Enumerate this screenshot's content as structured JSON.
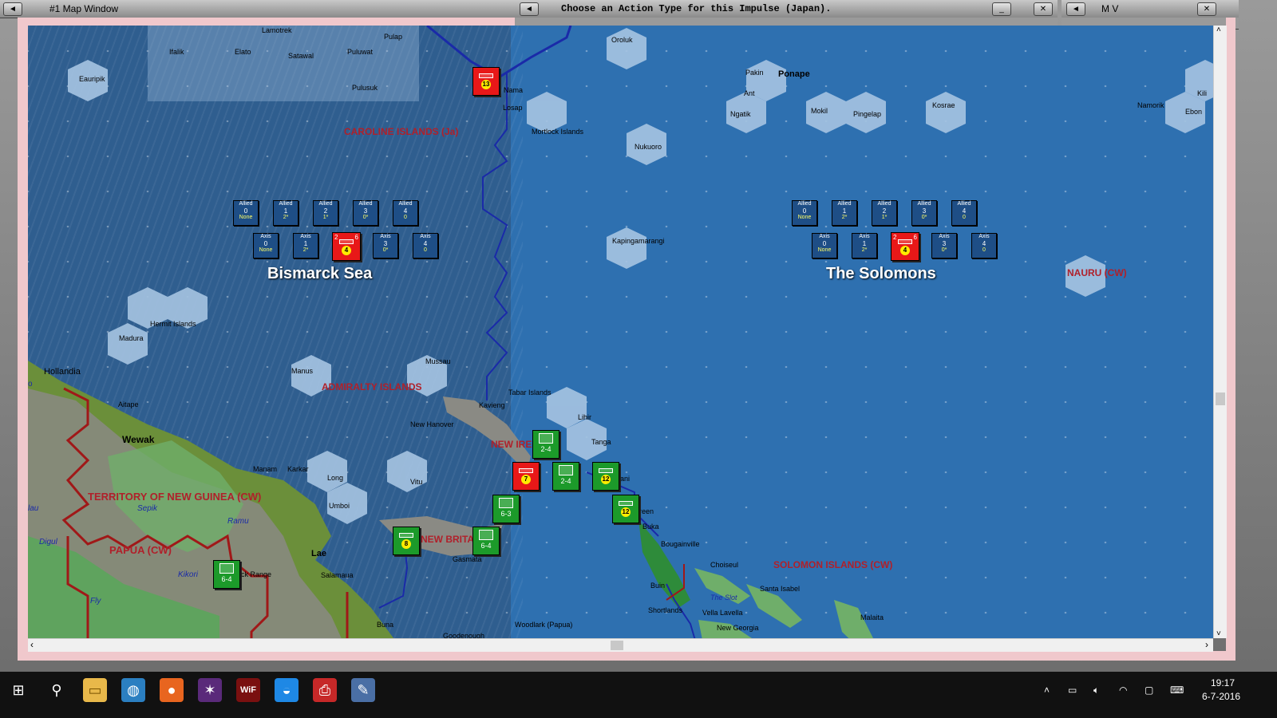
{
  "map_window": {
    "title": "#1 Map Window",
    "left_buttons": [
      "◄"
    ],
    "right_buttons": [
      "_",
      "□",
      "✕"
    ]
  },
  "action_window": {
    "title": "Choose an Action Type for this Impulse (Japan)."
  },
  "mv_window": {
    "title": "M V"
  },
  "sea_areas": {
    "bismarck": {
      "name": "Bismarck Sea",
      "allied_boxes": [
        {
          "label": "Allied",
          "n": "0",
          "v": "None"
        },
        {
          "label": "Allied",
          "n": "1",
          "v": "2*"
        },
        {
          "label": "Allied",
          "n": "2",
          "v": "1*"
        },
        {
          "label": "Allied",
          "n": "3",
          "v": "0*"
        },
        {
          "label": "Allied",
          "n": "4",
          "v": "0"
        }
      ],
      "axis_boxes": [
        {
          "label": "Axis",
          "n": "0",
          "v": "None"
        },
        {
          "label": "Axis",
          "n": "1",
          "v": "2*"
        },
        {
          "label": "Axis",
          "n": "2",
          "v": "6"
        },
        {
          "label": "Axis",
          "n": "3",
          "v": "0*"
        },
        {
          "label": "Axis",
          "n": "4",
          "v": "0"
        }
      ],
      "axis_unit": {
        "left": "2",
        "right": "6",
        "num": "4"
      }
    },
    "solomons": {
      "name": "The Solomons",
      "allied_boxes": [
        {
          "label": "Allied",
          "n": "0",
          "v": "None"
        },
        {
          "label": "Allied",
          "n": "1",
          "v": "2*"
        },
        {
          "label": "Allied",
          "n": "2",
          "v": "1*"
        },
        {
          "label": "Allied",
          "n": "3",
          "v": "0*"
        },
        {
          "label": "Allied",
          "n": "4",
          "v": "0"
        }
      ],
      "axis_boxes": [
        {
          "label": "Axis",
          "n": "0",
          "v": "None"
        },
        {
          "label": "Axis",
          "n": "1",
          "v": "2*"
        },
        {
          "label": "Axis",
          "n": "2",
          "v": "6"
        },
        {
          "label": "Axis",
          "n": "3",
          "v": "0*"
        },
        {
          "label": "Axis",
          "n": "4",
          "v": "0"
        }
      ],
      "axis_unit": {
        "left": "2",
        "right": "6",
        "num": "4"
      }
    }
  },
  "regions": {
    "caroline": "CAROLINE ISLANDS (Ja)",
    "admiralty": "ADMIRALTY ISLANDS",
    "new_ireland": "NEW IRE",
    "new_britain": "NEW BRITA",
    "tng": "TERRITORY OF NEW GUINEA (CW)",
    "papua": "PAPUA (CW)",
    "solomon_islands": "SOLOMON ISLANDS (CW)",
    "nauru": "NAURU (CW)"
  },
  "places": {
    "lamotrek": "Lamotrek",
    "pulap": "Pulap",
    "ifalik": "Ifalik",
    "elato": "Elato",
    "satawal": "Satawal",
    "puluwat": "Puluwat",
    "eauripik": "Eauripik",
    "pulusuk": "Pulusuk",
    "nama": "Nama",
    "losap": "Losap",
    "mortlock": "Mortlock Islands",
    "oroluk": "Oroluk",
    "pakin": "Pakin",
    "ponape": "Ponape",
    "ant": "Ant",
    "ngatik": "Ngatik",
    "mokil": "Mokil",
    "pingelap": "Pingelap",
    "kosrae": "Kosrae",
    "namorik": "Namorik",
    "kili": "Kili",
    "ebon": "Ebon",
    "nukuoro": "Nukuoro",
    "kapingamarangi": "Kapingamarangi",
    "hermit": "Hermit Islands",
    "madura": "Madura",
    "hollandia": "Hollandia",
    "manus": "Manus",
    "mussau": "Mussau",
    "aitape": "Aitape",
    "wewak": "Wewak",
    "tabar": "Tabar Islands",
    "kavieng": "Kavieng",
    "new_hanover": "New Hanover",
    "lihir": "Lihir",
    "tanga": "Tanga",
    "manam": "Manam",
    "karkar": "Karkar",
    "long": "Long",
    "vitu": "Vitu",
    "umboi": "Umboi",
    "sepik": "Sepik",
    "ramu": "Ramu",
    "digul": "Digul",
    "lae": "Lae",
    "kikori": "Kikori",
    "fly": "Fly",
    "range": "ck Range",
    "salamaua": "Salamaua",
    "gasmata": "Gasmata",
    "green": "reen",
    "ani": "ani",
    "buka": "Buka",
    "bougainville": "Bougainville",
    "choiseul": "Choiseul",
    "buin": "Buin",
    "santa_isabel": "Santa Isabel",
    "the_slot": "The Slot",
    "shortlands": "Shortlands",
    "vella": "Vella Lavella",
    "new_georgia": "New Georgia",
    "malaita": "Malaita",
    "buna": "Buna",
    "woodlark": "Woodlark (Papua)",
    "goodenough": "Goodenough",
    "lau": "lau",
    "o": "o"
  },
  "units": [
    {
      "id": "u13",
      "color": "red",
      "num": "13"
    },
    {
      "id": "u7",
      "color": "red",
      "num": "7"
    },
    {
      "id": "u24a",
      "color": "green",
      "str": "2-4"
    },
    {
      "id": "u24b",
      "color": "green",
      "str": "2-4"
    },
    {
      "id": "u12a",
      "color": "green",
      "num": "12"
    },
    {
      "id": "u12b",
      "color": "green",
      "num": "12"
    },
    {
      "id": "u63",
      "color": "green",
      "str": "6-3"
    },
    {
      "id": "u64a",
      "color": "green",
      "str": "6-4"
    },
    {
      "id": "u64b",
      "color": "green",
      "str": "6-4"
    },
    {
      "id": "u8",
      "color": "green",
      "num": "8"
    }
  ],
  "taskbar": {
    "time": "19:17",
    "date": "6-7-2016"
  },
  "colors": {
    "ocean_dark": "#2f5e8f",
    "ocean_light": "#2e70b0",
    "axis_red": "#e81818",
    "allied_green": "#1c9a2a",
    "region_label": "#b0202a",
    "frame_pink": "#f0c8cc"
  }
}
